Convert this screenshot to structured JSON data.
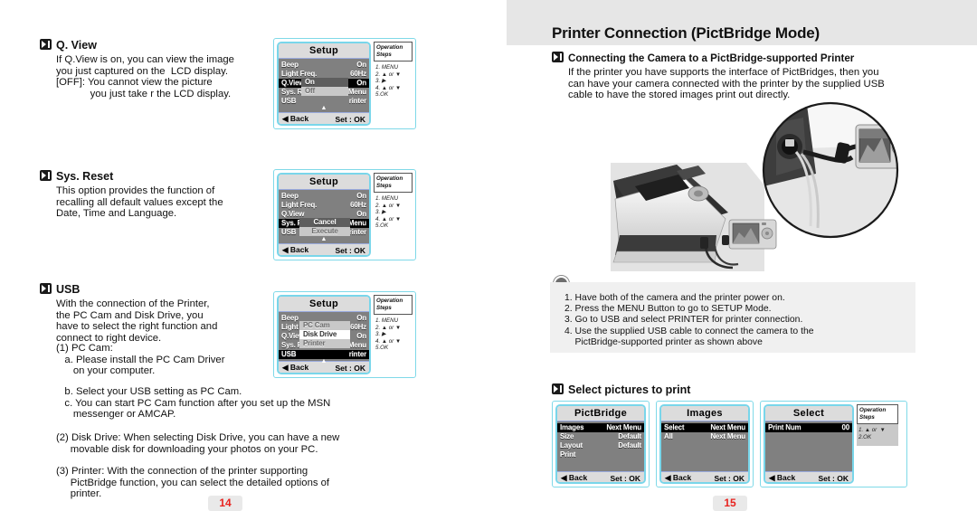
{
  "left_page": {
    "page_number": "14",
    "sections": [
      {
        "heading": "Q. View",
        "body": "If Q.View is on, you can view the image\nyou just captured on the  LCD display.\n[OFF]: You cannot view the picture\n            you just take r the LCD display."
      },
      {
        "heading": "Sys. Reset",
        "body": "This option provides the function of\nrecalling all default values except the\nDate, Time and Language."
      },
      {
        "heading": "USB",
        "body": "With the connection of the Printer,\nthe PC Cam and Disk Drive, you\nhave to select the right function and\nconnect to right device."
      }
    ],
    "usb_list_1": "(1) PC Cam:\n   a. Please install the PC Cam Driver\n      on your computer.",
    "usb_list_2": "   b. Select your USB setting as PC Cam.\n   c. You can start PC Cam function after you set up the MSN\n      messenger or AMCAP.",
    "usb_list_3": "(2) Disk Drive: When selecting Disk Drive, you can have a new\n     movable disk for downloading your photos on your PC.",
    "usb_list_4": "(3) Printer: With the connection of the printer supporting\n     PictBridge function, you can select the detailed options of\n     printer."
  },
  "setup_menu": {
    "title": "Setup",
    "rows": [
      {
        "label": "Beep",
        "value": "On"
      },
      {
        "label": "Light Freq.",
        "value": "60Hz"
      },
      {
        "label": "Q.View",
        "value": "On"
      },
      {
        "label": "Sys. Re",
        "value": "Menu"
      },
      {
        "label": "USB",
        "value": "rinter"
      }
    ],
    "back_label": "Back",
    "set_label": "Set : OK",
    "scroll_glyph": "▲"
  },
  "lcd_qview": {
    "selected_row_index": 2,
    "popup": [
      {
        "text": "On",
        "style": "dark"
      },
      {
        "text": "Off",
        "style": "light"
      }
    ]
  },
  "lcd_sysreset": {
    "selected_row_index": 3,
    "popup": [
      {
        "text": "Cancel",
        "style": "dark"
      },
      {
        "text": "Execute",
        "style": "light"
      }
    ]
  },
  "lcd_usb": {
    "selected_row_index": 4,
    "popup": [
      {
        "text": "PC Cam",
        "style": "light"
      },
      {
        "text": "Disk Drive",
        "style": "white"
      },
      {
        "text": "Printer",
        "style": "light"
      }
    ]
  },
  "operation_steps_setup": {
    "title_line1": "Operation",
    "title_line2": "Steps",
    "steps": "1. MENU\n2. ▲ or ▼\n3. ▶\n4. ▲ or ▼\n5.OK"
  },
  "operation_steps_print": {
    "title_line1": "Operation",
    "title_line2": "Steps",
    "steps": "1. ▲ or  ▼\n2.OK"
  },
  "right_page": {
    "page_number": "15",
    "header_title": "Printer Connection (PictBridge Mode)",
    "section1_heading": "Connecting the Camera to a PictBridge-supported Printer",
    "section1_body": "If the printer you have supports the interface of PictBridges, then you\ncan have your camera connected with the printer by the supplied USB\ncable to have the stored images print out directly.",
    "note_steps": "1. Have both of the camera and the printer power on.\n2. Press the MENU Button to go to SETUP Mode.\n3. Go to USB and select PRINTER for printer connection.\n4. Use the supplied USB cable to connect the camera to the\n    PictBridge-supported printer as shown above",
    "section2_heading": "Select pictures to print",
    "photo_alt": "printer-camera-usb-connection-photo"
  },
  "print_lcds": [
    {
      "title": "PictBridge",
      "rows": [
        {
          "label": "Images",
          "value": "Next Menu",
          "selected": true
        },
        {
          "label": "Size",
          "value": "Default",
          "selected": false
        },
        {
          "label": "Layout",
          "value": "Default",
          "selected": false
        },
        {
          "label": "Print",
          "value": "",
          "selected": false
        }
      ],
      "back_label": "Back",
      "set_label": "Set : OK"
    },
    {
      "title": "Images",
      "rows": [
        {
          "label": "Select",
          "value": "Next Menu",
          "selected": true
        },
        {
          "label": "All",
          "value": "Next Menu",
          "selected": false
        }
      ],
      "back_label": "Back",
      "set_label": "Set : OK"
    },
    {
      "title": "Select",
      "rows": [
        {
          "label": "Print Num",
          "value": "00",
          "selected": true
        }
      ],
      "back_label": "Back",
      "set_label": "Set : OK"
    }
  ],
  "colors": {
    "lcd_border": "#79d6ea",
    "lcd_body": "#808080",
    "lcd_chrome": "#dcdcdc",
    "selected_row": "#000000",
    "header_band": "#e6e6e6",
    "note_box": "#f0f0f0",
    "page_number": "#e8231f"
  }
}
